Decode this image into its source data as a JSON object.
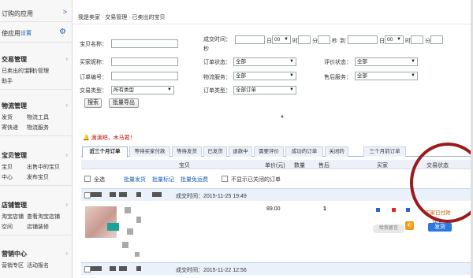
{
  "sidebar": {
    "top_label": "订购的应用",
    "top_arrow": ">",
    "sub_label": "使应用",
    "settings_label": "设置",
    "groups": [
      {
        "title": "交易管理",
        "rows": [
          [
            "已卖出的宝贝",
            "评价管理"
          ],
          [
            "助手",
            ""
          ]
        ]
      },
      {
        "title": "物流管理",
        "rows": [
          [
            "发货",
            "物流工具"
          ],
          [
            "寄快递",
            "物流服务"
          ]
        ]
      },
      {
        "title": "宝贝管理",
        "rows": [
          [
            "宝贝",
            "出售中的宝贝"
          ],
          [
            "中心",
            "发布宝贝"
          ]
        ]
      },
      {
        "title": "店铺管理",
        "rows": [
          [
            "淘宝店铺",
            "查看淘宝店铺"
          ],
          [
            "空间",
            "店铺装修"
          ]
        ]
      },
      {
        "title": "营销中心",
        "rows": [
          [
            "营销专区",
            "活动报名"
          ]
        ]
      }
    ]
  },
  "breadcrumb": "我是卖家 · 交易管理 · 已卖出的宝贝",
  "filters": {
    "item_name": "宝贝名称：",
    "buyer_nick": "买家昵称：",
    "order_no": "订单编号：",
    "trade_type": "交易类型：",
    "trade_type_value": "所有类型",
    "deal_time": "成交时间：",
    "day": "日",
    "hour_value": "00",
    "hour": "时",
    "minute": "分",
    "second": "秒",
    "to": "到",
    "order_status": "订单状态：",
    "order_status_value": "全部",
    "logistics": "物流服务：",
    "logistics_value": "全部",
    "order_type": "订单类型：",
    "order_type_value": "全部订单",
    "review_status": "评价状态：",
    "review_status_value": "全部",
    "after_sale": "售后服务：",
    "after_sale_value": "全部",
    "search_btn": "搜索",
    "export_btn": "批量导出",
    "collapse": "▲"
  },
  "hint": "🔔 滴滴吧，木马君！",
  "tabs": [
    "近三个月订单",
    "等待买家付款",
    "等待发货",
    "已发货",
    "退款中",
    "需要评价",
    "成功的订单",
    "关闭的",
    "三个月前订单"
  ],
  "table_header": {
    "item": "宝贝",
    "price": "单价(元)",
    "qty": "数量",
    "after_sale": "售后",
    "buyer": "买家",
    "status": "交易状态"
  },
  "actions": {
    "select_all": "全选",
    "batch_ship": "批量发货",
    "batch_mark": "批量标记",
    "batch_free": "批量免运费",
    "hide_closed": "不显示已关闭的订单"
  },
  "orders": [
    {
      "deal_time": "成交时间：2015-11-25 19:49",
      "price": "89.00",
      "qty": "1",
      "status": "买家已付款",
      "status2": "详情",
      "ship": "发货",
      "wangwang": "给我留言"
    },
    {
      "deal_time": "成交时间：2015-11-22 12:56"
    }
  ]
}
